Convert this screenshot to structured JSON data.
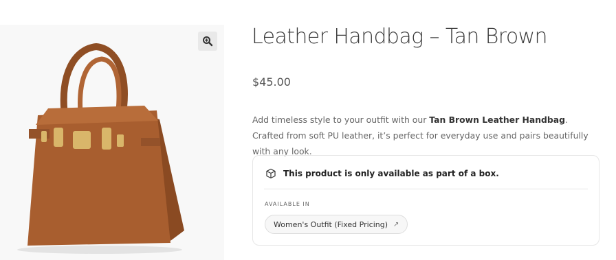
{
  "product": {
    "title": "Leather Handbag – Tan Brown",
    "price": "$45.00",
    "description_before": "Add timeless style to your outfit with our ",
    "description_bold": "Tan Brown Leather Handbag",
    "description_after": ". Crafted from soft PU leather, it’s perfect for everyday use and pairs beautifully with any look."
  },
  "gallery": {
    "zoom_icon": "magnifier-plus-icon",
    "image_icon": "handbag"
  },
  "box_notice": {
    "icon": "cube-icon",
    "text": "This product is only available as part of a box.",
    "available_label": "AVAILABLE IN",
    "link_label": "Women's Outfit (Fixed Pricing)",
    "link_icon": "arrow-up-right-icon"
  },
  "colors": {
    "bag": "#a85e2f",
    "text": "#3a3a3a"
  }
}
